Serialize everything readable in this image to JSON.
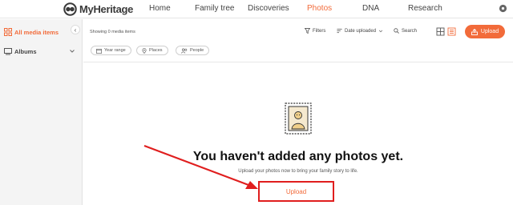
{
  "brand": {
    "name": "MyHeritage",
    "accent": "#f26b3a"
  },
  "nav": {
    "items": [
      {
        "label": "Home",
        "active": false
      },
      {
        "label": "Family tree",
        "active": false
      },
      {
        "label": "Discoveries",
        "active": false
      },
      {
        "label": "Photos",
        "active": true
      },
      {
        "label": "DNA",
        "active": false
      },
      {
        "label": "Research",
        "active": false
      }
    ],
    "settings_icon": "gear-icon"
  },
  "sidebar": {
    "items": [
      {
        "label": "All media items",
        "icon": "grid-icon",
        "active": true
      },
      {
        "label": "Albums",
        "icon": "albums-icon",
        "active": false
      }
    ],
    "collapse_glyph": "‹"
  },
  "toolbar": {
    "showing": "Showing 0 media items",
    "filters_label": "Filters",
    "sort_label": "Date uploaded",
    "search_label": "Search",
    "upload_label": "Upload"
  },
  "chips": [
    {
      "label": "Year range",
      "icon": "calendar-icon"
    },
    {
      "label": "Places",
      "icon": "pin-icon"
    },
    {
      "label": "People",
      "icon": "people-icon"
    }
  ],
  "empty_state": {
    "title": "You haven't added any photos yet.",
    "subtitle": "Upload your photos now to bring your family story to life.",
    "upload_label": "Upload",
    "illustration": "stamp-portrait-icon"
  },
  "annotation_color": "#e01e1e"
}
